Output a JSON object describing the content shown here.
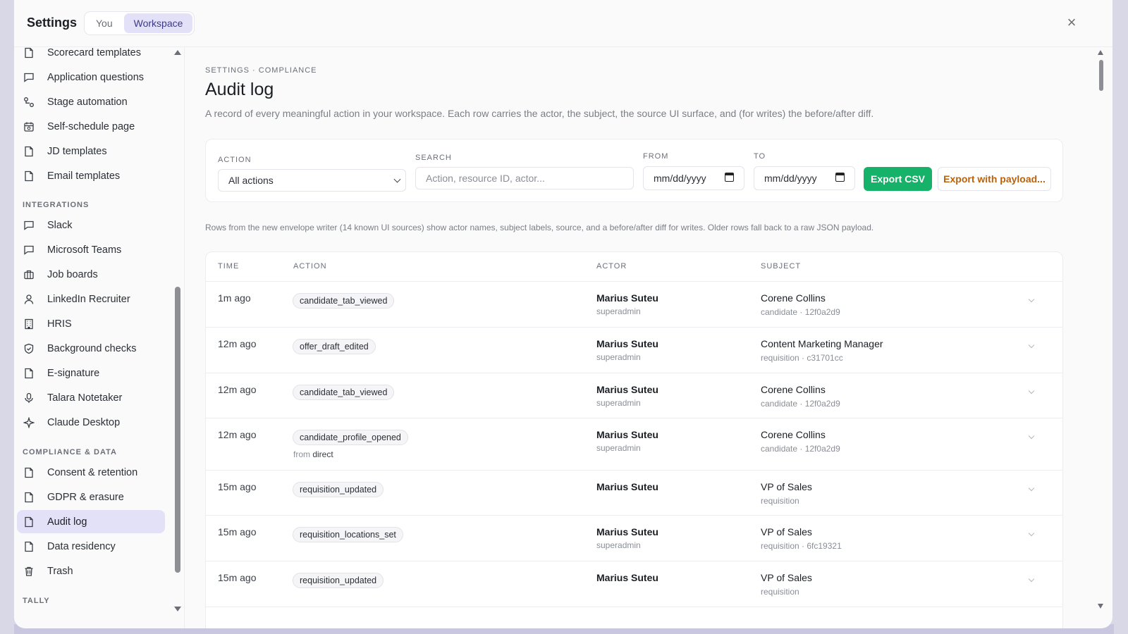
{
  "header": {
    "title": "Settings",
    "tabs": [
      {
        "label": "You",
        "active": false
      },
      {
        "label": "Workspace",
        "active": true
      }
    ],
    "close_icon": "close-icon"
  },
  "sidebar": {
    "items_top": [
      {
        "label": "Scorecard templates",
        "icon": "doc-icon"
      },
      {
        "label": "Application questions",
        "icon": "chat-icon"
      },
      {
        "label": "Stage automation",
        "icon": "flow-icon"
      },
      {
        "label": "Self-schedule page",
        "icon": "calendar-icon"
      },
      {
        "label": "JD templates",
        "icon": "doc-icon"
      },
      {
        "label": "Email templates",
        "icon": "doc-icon"
      }
    ],
    "section_integrations": "INTEGRATIONS",
    "items_integrations": [
      {
        "label": "Slack",
        "icon": "chat-icon"
      },
      {
        "label": "Microsoft Teams",
        "icon": "chat-icon"
      },
      {
        "label": "Job boards",
        "icon": "briefcase-icon"
      },
      {
        "label": "LinkedIn Recruiter",
        "icon": "person-icon"
      },
      {
        "label": "HRIS",
        "icon": "building-icon"
      },
      {
        "label": "Background checks",
        "icon": "shield-icon"
      },
      {
        "label": "E-signature",
        "icon": "doc-icon"
      },
      {
        "label": "Talara Notetaker",
        "icon": "mic-icon"
      },
      {
        "label": "Claude Desktop",
        "icon": "sparkle-icon"
      }
    ],
    "section_compliance": "COMPLIANCE & DATA",
    "items_compliance": [
      {
        "label": "Consent & retention",
        "icon": "doc-icon"
      },
      {
        "label": "GDPR & erasure",
        "icon": "doc-icon"
      },
      {
        "label": "Audit log",
        "icon": "doc-icon",
        "active": true
      },
      {
        "label": "Data residency",
        "icon": "doc-icon"
      },
      {
        "label": "Trash",
        "icon": "trash-icon"
      }
    ],
    "section_tally": "TALLY"
  },
  "main": {
    "breadcrumb": "SETTINGS · COMPLIANCE",
    "title": "Audit log",
    "description": "A record of every meaningful action in your workspace. Each row carries the actor, the subject, the source UI surface, and (for writes) the before/after diff.",
    "filters": {
      "action_label": "ACTION",
      "action_value": "All actions",
      "search_label": "SEARCH",
      "search_placeholder": "Action, resource ID, actor...",
      "from_label": "FROM",
      "from_placeholder": "mm/dd/yyyy",
      "to_label": "TO",
      "to_placeholder": "mm/dd/yyyy",
      "export_csv": "Export CSV",
      "export_payload": "Export with payload..."
    },
    "note": "Rows from the new envelope writer (14 known UI sources) show actor names, subject labels, source, and a before/after diff for writes. Older rows fall back to a raw JSON payload.",
    "table": {
      "columns": [
        "TIME",
        "ACTION",
        "ACTOR",
        "SUBJECT"
      ],
      "rows": [
        {
          "time": "1m ago",
          "action": "candidate_tab_viewed",
          "from": "",
          "actor": "Marius Suteu",
          "role": "superadmin",
          "subject": "Corene Collins",
          "subject_meta": "candidate · 12f0a2d9"
        },
        {
          "time": "12m ago",
          "action": "offer_draft_edited",
          "from": "",
          "actor": "Marius Suteu",
          "role": "superadmin",
          "subject": "Content Marketing Manager",
          "subject_meta": "requisition · c31701cc"
        },
        {
          "time": "12m ago",
          "action": "candidate_tab_viewed",
          "from": "",
          "actor": "Marius Suteu",
          "role": "superadmin",
          "subject": "Corene Collins",
          "subject_meta": "candidate · 12f0a2d9"
        },
        {
          "time": "12m ago",
          "action": "candidate_profile_opened",
          "from_prefix": "from",
          "from": "direct",
          "actor": "Marius Suteu",
          "role": "superadmin",
          "subject": "Corene Collins",
          "subject_meta": "candidate · 12f0a2d9"
        },
        {
          "time": "15m ago",
          "action": "requisition_updated",
          "from": "",
          "actor": "Marius Suteu",
          "role": "",
          "subject": "VP of Sales",
          "subject_meta": "requisition"
        },
        {
          "time": "15m ago",
          "action": "requisition_locations_set",
          "from": "",
          "actor": "Marius Suteu",
          "role": "superadmin",
          "subject": "VP of Sales",
          "subject_meta": "requisition · 6fc19321"
        },
        {
          "time": "15m ago",
          "action": "requisition_updated",
          "from": "",
          "actor": "Marius Suteu",
          "role": "",
          "subject": "VP of Sales",
          "subject_meta": "requisition"
        }
      ]
    }
  },
  "colors": {
    "accent": "#e3e1f8",
    "primary_button": "#17b26a",
    "export_payload_text": "#b8620d"
  }
}
